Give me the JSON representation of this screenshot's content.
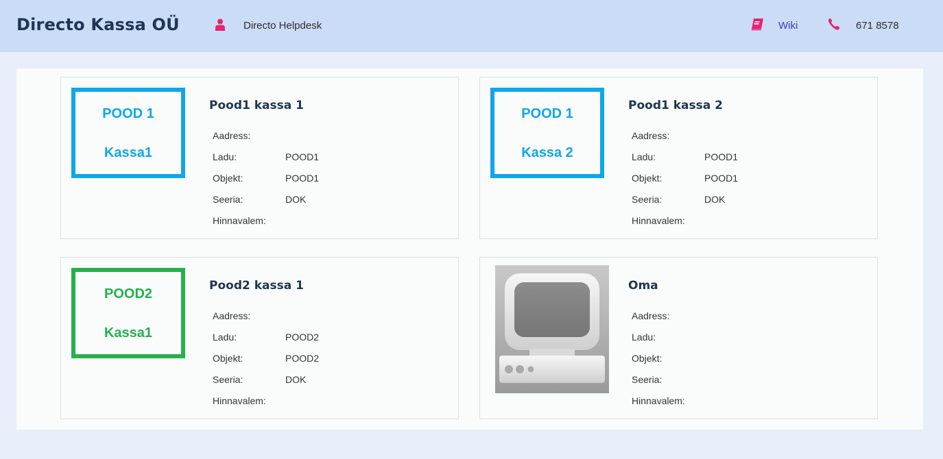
{
  "header": {
    "company": "Directo Kassa OÜ",
    "helpdesk": "Directo Helpdesk",
    "wiki": "Wiki",
    "phone": "671 8578"
  },
  "labels": {
    "address": "Aadress:",
    "warehouse": "Ladu:",
    "object": "Objekt:",
    "series": "Seeria:",
    "price_formula": "Hinnavalem:"
  },
  "cards": [
    {
      "title": "Pood1 kassa 1",
      "thumb": {
        "line1": "POOD 1",
        "line2": "Kassa1",
        "color": "#0fa6ea"
      },
      "address": "",
      "warehouse": "POOD1",
      "object": "POOD1",
      "series": "DOK",
      "price_formula": ""
    },
    {
      "title": "Pood1 kassa 2",
      "thumb": {
        "line1": "POOD 1",
        "line2": "Kassa 2",
        "color": "#0fa6ea"
      },
      "address": "",
      "warehouse": "POOD1",
      "object": "POOD1",
      "series": "DOK",
      "price_formula": ""
    },
    {
      "title": "Pood2 kassa 1",
      "thumb": {
        "line1": "POOD2",
        "line2": "Kassa1",
        "color": "#24b14c"
      },
      "address": "",
      "warehouse": "POOD2",
      "object": "POOD2",
      "series": "DOK",
      "price_formula": ""
    },
    {
      "title": "Oma",
      "thumb": {
        "icon": "computer-terminal-icon"
      },
      "address": "",
      "warehouse": "",
      "object": "",
      "series": "",
      "price_formula": ""
    }
  ],
  "icons": {
    "user": "user-icon",
    "wiki": "book-icon",
    "phone": "phone-icon"
  },
  "colors": {
    "header_bg": "#cbdcf7",
    "page_bg": "#e9eefb",
    "accent_pink": "#e8246f",
    "blue_frame": "#0fa6ea",
    "green_frame": "#24b14c",
    "title_navy": "#1f3552"
  }
}
